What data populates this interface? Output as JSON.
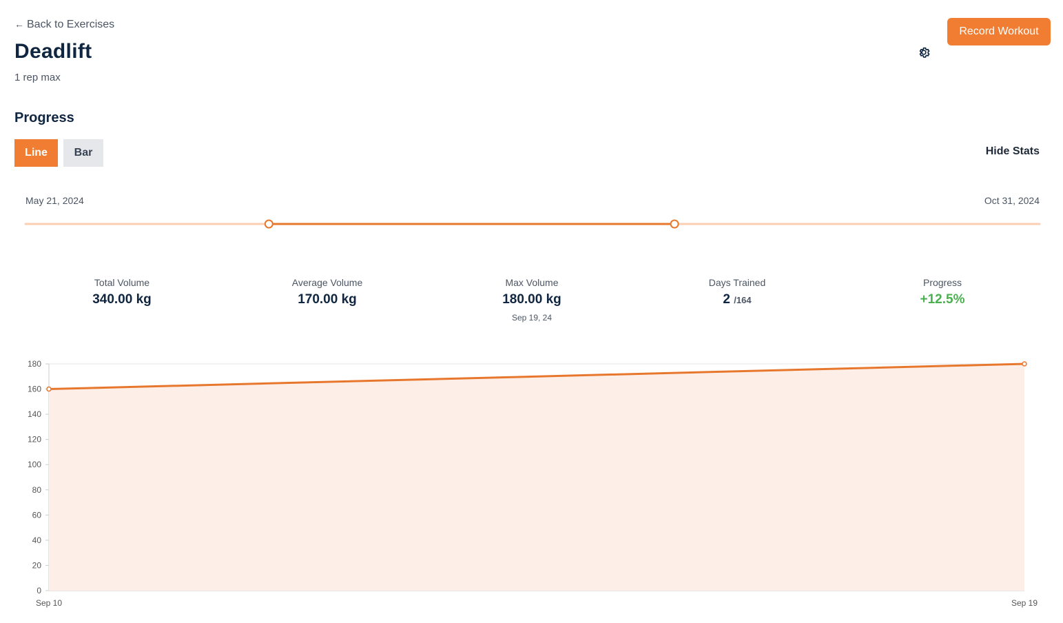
{
  "header": {
    "back_label": "Back to Exercises",
    "back_arrow": "←",
    "title": "Deadlift",
    "subtitle": "1 rep max",
    "settings_icon": "gear-icon",
    "record_button": "Record Workout"
  },
  "progress": {
    "section_title": "Progress",
    "chart_toggle": {
      "line_label": "Line",
      "bar_label": "Bar",
      "selected": "Line"
    },
    "hide_stats_label": "Hide Stats",
    "date_range": {
      "min_label": "May 21, 2024",
      "max_label": "Oct 31, 2024",
      "selected_start_fraction": 0.24,
      "selected_end_fraction": 0.64
    }
  },
  "stats": [
    {
      "label": "Total Volume",
      "value": "340.00 kg"
    },
    {
      "label": "Average Volume",
      "value": "170.00 kg"
    },
    {
      "label": "Max Volume",
      "value": "180.00 kg",
      "note": "Sep 19, 24"
    },
    {
      "label": "Days Trained",
      "value": "2",
      "sub": "/164"
    },
    {
      "label": "Progress",
      "value": "+12.5%",
      "color": "#4caf50"
    }
  ],
  "colors": {
    "accent": "#f07d31",
    "accent_light": "#fbcfb3",
    "area_fill": "#fdefe7",
    "positive": "#4caf50"
  },
  "chart_data": {
    "type": "area",
    "x": [
      "Sep 10",
      "Sep 19"
    ],
    "values": [
      160,
      180
    ],
    "ylim": [
      0,
      180
    ],
    "yticks": [
      0,
      20,
      40,
      60,
      80,
      100,
      120,
      140,
      160,
      180
    ],
    "grid": true,
    "title": "",
    "xlabel": "",
    "ylabel": ""
  }
}
